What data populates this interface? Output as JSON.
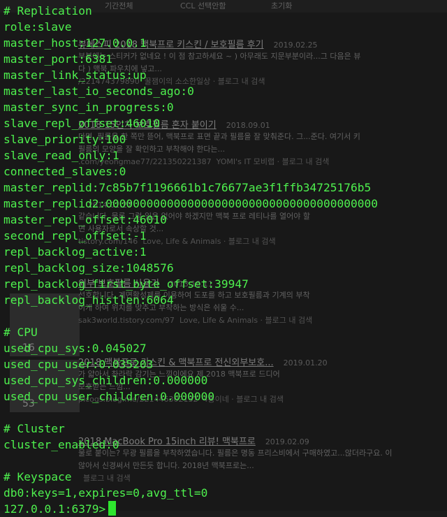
{
  "background_page": {
    "top_bar": {
      "period": "기간전체",
      "ccl": "CCL 선택안함",
      "reset": "초기화"
    },
    "results": [
      {
        "title": "뷰에스피 2018 맥북프로 키스킨 / 보호필름 후기",
        "date": "2019.02.25",
        "snippet1": "부분에는 스티커가 없네요 ! 이 점 참고하세요 ~ ) 아무래도 지문부분이라...그 다음은 뷰",
        "snippet2": "다 ) 맥북 파우치에 넣고...",
        "url": "/221474379890",
        "meta": "꿀잼이의 소소한일상 ·  블로그 내 검색"
      },
      {
        "title": "2018 15인치 보호필름 혼자 붙이기",
        "date": "2018.09.01",
        "snippet1": "다면, 필름을 한 쪽만 뜯어, 맥북프로 표면 끝과 필름을 잘 맞춰준다. 그...준다. 여기서 키",
        "snippet2": "필름의 모양을 잘 확인하고 부착해야 한다는...",
        "url": ".com/yeongmae77/221350221387",
        "meta": "YOMI's IT 모비랩 ·  블로그 내 검색"
      },
      {
        "title": "",
        "date": "2014.01.27",
        "snippet1": "같습니다. 물론 그럴 일은 없어야 하겠지만 맥북 프로 레티나를 열어야 할",
        "snippet2": "면 사용자로서 속상할 것...",
        "url": "tistory.com/146",
        "meta": "Love, Life & Animals ·  블로그 내 검색"
      },
      {
        "title": "외부 보호필름 사용기",
        "date": "2013.10.11",
        "snippet1": "선호합니다. 계면활성제를 이용하여 도포를 하고 보호필름과 기계의 부착",
        "snippet2": "이게 하여 위치를 맞추고 부착하는 방식은 쉬울 수...",
        "url": "sak3world.tistory.com/97",
        "meta": "Love, Life & Animals ·  블로그 내 검색"
      },
      {
        "title": "2018 맥북프로 키스킨 & 맥북프로 전신외부보호...",
        "date": "2019.01.20",
        "snippet1": "가 얇아서 촤라락 감기는 느낌이에요 제 2018 맥북프로 드디어",
        "snippet2": "보호받는 느낌...",
        "url": "picogs.blog.me/221446302132",
        "meta": "4통이네 ·  블로그 내 검색"
      },
      {
        "title": "2018 MacBook Pro 15inch 리뷰! 맥북프로",
        "date": "2019.02.09",
        "snippet1": "물로 붙이는? 무광 필름을 부착하였습니다. 필름은 명동 프리스비에서 구매하였고...않더라구요. 이",
        "snippet2": "않아서 신경써서 만든듯 합니다. 2018년 맥북프로는...",
        "url": "",
        "meta": "블로그 내 검색"
      }
    ],
    "thumb_counts": [
      "16",
      "53"
    ]
  },
  "terminal": {
    "lines": [
      "# Replication",
      "role:slave",
      "master_host:127.0.0.1",
      "master_port:6381",
      "master_link_status:up",
      "master_last_io_seconds_ago:0",
      "master_sync_in_progress:0",
      "slave_repl_offset:46010",
      "slave_priority:100",
      "slave_read_only:1",
      "connected_slaves:0",
      "master_replid:7c85b7f1196661b1c76677ae3f1ffb34725176b5",
      "master_replid2:0000000000000000000000000000000000000000",
      "master_repl_offset:46010",
      "second_repl_offset:-1",
      "repl_backlog_active:1",
      "repl_backlog_size:1048576",
      "repl_backlog_first_byte_offset:39947",
      "repl_backlog_histlen:6064",
      "",
      "# CPU",
      "used_cpu_sys:0.045027",
      "used_cpu_user:0.035203",
      "used_cpu_sys_children:0.000000",
      "used_cpu_user_children:0.000000",
      "",
      "# Cluster",
      "cluster_enabled:0",
      "",
      "# Keyspace",
      "db0:keys=1,expires=0,avg_ttl=0"
    ],
    "prompt": "127.0.0.1:6379>",
    "text_color": "#4ef14e",
    "cursor_color": "#2ee52e"
  }
}
